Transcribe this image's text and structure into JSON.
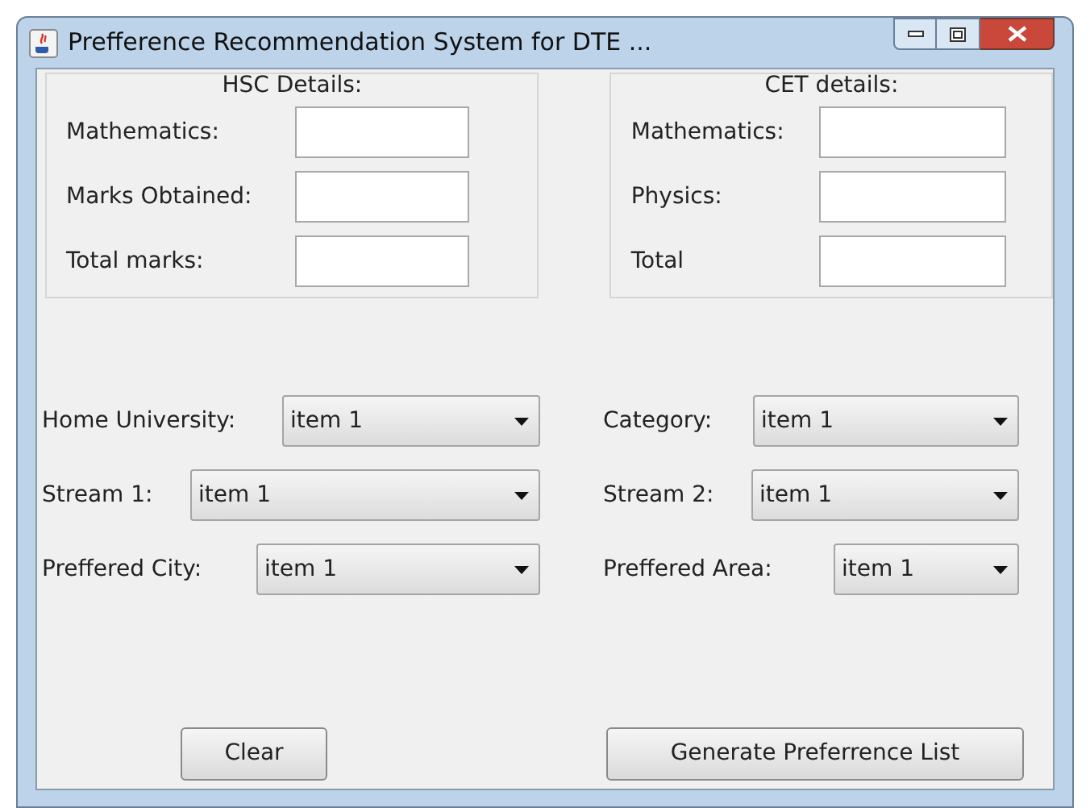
{
  "window": {
    "title": "Prefference Recommendation System for DTE ..."
  },
  "panels": [
    {
      "title": "HSC Details:",
      "fields": [
        {
          "label": "Mathematics:"
        },
        {
          "label": "Marks Obtained:"
        },
        {
          "label": "Total marks:"
        }
      ]
    },
    {
      "title": "CET details:",
      "fields": [
        {
          "label": "Mathematics:"
        },
        {
          "label": "Physics:"
        },
        {
          "label": "Total"
        }
      ]
    }
  ],
  "dropdown_columns": [
    [
      {
        "label": "Home University:",
        "value": "item 1"
      },
      {
        "label": "Stream 1:",
        "value": "item 1"
      },
      {
        "label": "Preffered City:",
        "value": "item 1"
      }
    ],
    [
      {
        "label": "Category:",
        "value": "item 1"
      },
      {
        "label": "Stream 2:",
        "value": "item 1"
      },
      {
        "label": "Preffered Area:",
        "value": "item 1"
      }
    ]
  ],
  "buttons": [
    "Clear",
    "Generate Preferrence List"
  ]
}
